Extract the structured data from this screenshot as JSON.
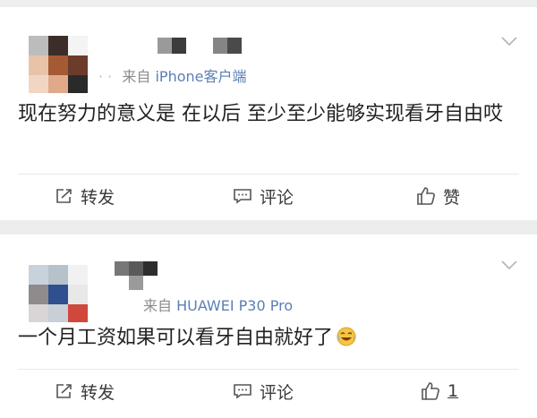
{
  "posts": [
    {
      "source_prefix": "来自",
      "source_device": "iPhone客户端",
      "time_masked": "· ·",
      "content": "现在努力的意义是 在以后 至少至少能够实现看牙自由哎",
      "actions": {
        "repost": "转发",
        "comment": "评论",
        "like": "赞"
      }
    },
    {
      "source_prefix": "来自",
      "source_device": "HUAWEI P30 Pro",
      "content": "一个月工资如果可以看牙自由就好了",
      "emoji": "laughing-crying-emoji",
      "actions": {
        "repost": "转发",
        "comment": "评论",
        "like": "1"
      }
    }
  ],
  "colors": {
    "link": "#5b7fb4",
    "meta": "#8c8c8c",
    "text": "#222222",
    "background": "#ededed"
  }
}
